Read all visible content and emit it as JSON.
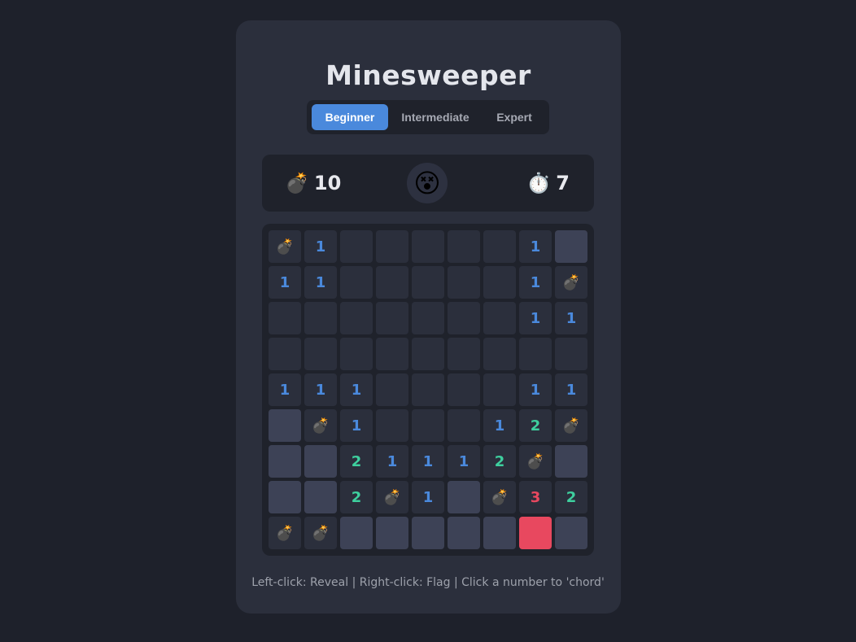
{
  "title": "Minesweeper",
  "tabs": [
    {
      "label": "Beginner",
      "active": true
    },
    {
      "label": "Intermediate",
      "active": false
    },
    {
      "label": "Expert",
      "active": false
    }
  ],
  "status": {
    "mine_icon": "💣",
    "mine_count": "10",
    "face": "😵",
    "timer_icon": "⏱️",
    "time": "7"
  },
  "board": {
    "rows": [
      [
        "M",
        "1",
        "",
        "",
        "",
        "",
        "",
        "1",
        "H"
      ],
      [
        "1",
        "1",
        "",
        "",
        "",
        "",
        "",
        "1",
        "M"
      ],
      [
        "",
        "",
        "",
        "",
        "",
        "",
        "",
        "1",
        "1"
      ],
      [
        "",
        "",
        "",
        "",
        "",
        "",
        "",
        "",
        ""
      ],
      [
        "1",
        "1",
        "1",
        "",
        "",
        "",
        "",
        "1",
        "1"
      ],
      [
        "H",
        "M",
        "1",
        "",
        "",
        "",
        "1",
        "2",
        "M"
      ],
      [
        "H",
        "H",
        "2",
        "1",
        "1",
        "1",
        "2",
        "M",
        "H"
      ],
      [
        "H",
        "H",
        "2",
        "M",
        "1",
        "H",
        "M",
        "3",
        "2"
      ],
      [
        "M",
        "M",
        "H",
        "H",
        "H",
        "H",
        "H",
        "X",
        "H"
      ]
    ],
    "mine_glyph": "💣",
    "number_colors": {
      "1": "#4a89dc",
      "2": "#3ecf9e",
      "3": "#e8485f"
    }
  },
  "footer": "Left-click: Reveal | Right-click: Flag | Click a number to 'chord'"
}
